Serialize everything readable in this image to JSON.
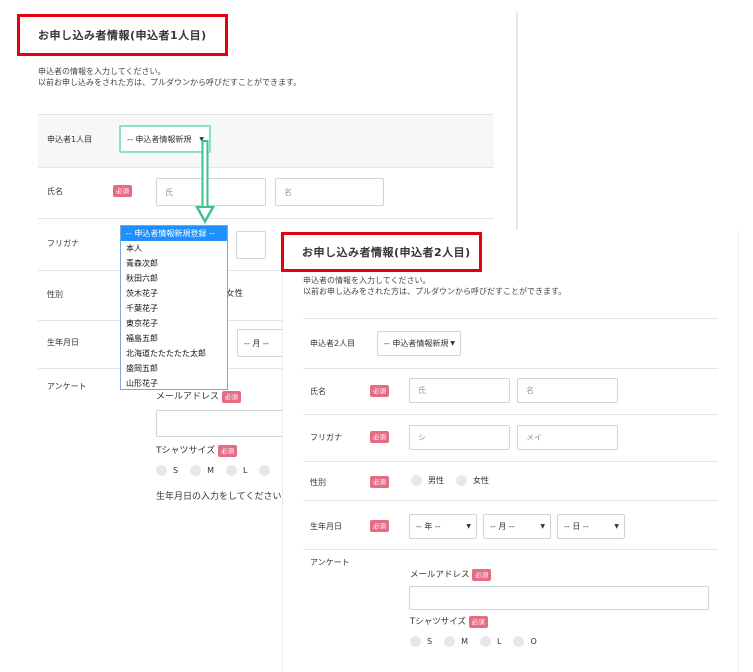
{
  "form1": {
    "title": "お申し込み者情報(申込者1人目)",
    "desc_line1": "申込者の情報を入力してください。",
    "desc_line2": "以前お申し込みをされた方は、プルダウンから呼びだすことができます。",
    "applicant_label": "申込者1人目",
    "applicant_select_value": "-- 申込者情報新規",
    "name_label": "氏名",
    "required": "必須",
    "sei_placeholder": "氏",
    "mei_placeholder": "名",
    "furigana_label": "フリガナ",
    "gender_label": "性別",
    "gender_partial": "女性",
    "birthdate_label": "生年月日",
    "month_partial": "-- 月 --",
    "survey_label": "アンケート",
    "email_label": "メールアドレス",
    "tshirt_label": "Tシャツサイズ",
    "sizes": [
      "S",
      "M",
      "L"
    ],
    "birth_note": "生年月日の入力をしてください"
  },
  "dropdown": {
    "options": [
      "-- 申込者情報新規登録 --",
      "本人",
      "青森次郎",
      "秋田六郎",
      "茨木花子",
      "千葉花子",
      "東京花子",
      "福島五郎",
      "北海道たたたたた太郎",
      "盛岡五郎",
      "山形花子"
    ]
  },
  "form2": {
    "title": "お申し込み者情報(申込者2人目)",
    "desc_line1": "申込者の情報を入力してください。",
    "desc_line2": "以前お申し込みをされた方は、プルダウンから呼びだすことができます。",
    "applicant_label": "申込者2人目",
    "applicant_select_value": "-- 申込者情報新規",
    "name_label": "氏名",
    "required": "必須",
    "sei_placeholder": "氏",
    "mei_placeholder": "名",
    "furigana_label": "フリガナ",
    "furi_sei_placeholder": "シ",
    "furi_mei_placeholder": "メイ",
    "gender_label": "性別",
    "male": "男性",
    "female": "女性",
    "birthdate_label": "生年月日",
    "year": "-- 年 --",
    "month": "-- 月 --",
    "day": "-- 日 --",
    "survey_label": "アンケート",
    "email_label": "メールアドレス",
    "tshirt_label": "Tシャツサイズ",
    "sizes": [
      "S",
      "M",
      "L",
      "O"
    ]
  },
  "colors": {
    "title_border": "#e3000f",
    "required_badge": "#e76b84",
    "arrow": "#3cc28a",
    "dropdown_selected": "#1e90ff"
  }
}
